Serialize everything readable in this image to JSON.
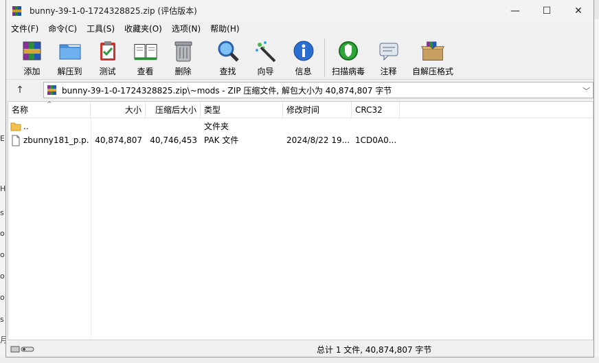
{
  "window": {
    "title": "bunny-39-1-0-1724328825.zip (评估版本)",
    "minimize": "—",
    "maximize": "☐",
    "close": "✕"
  },
  "menu": [
    "文件(F)",
    "命令(C)",
    "工具(S)",
    "收藏夹(O)",
    "选项(N)",
    "帮助(H)"
  ],
  "toolbar": {
    "add": "添加",
    "extract_to": "解压到",
    "test": "测试",
    "view": "查看",
    "delete": "删除",
    "find": "查找",
    "wizard": "向导",
    "info": "信息",
    "virus_scan": "扫描病毒",
    "comment": "注释",
    "sfx": "自解压格式"
  },
  "address": {
    "path": "bunny-39-1-0-1724328825.zip\\~mods - ZIP 压缩文件, 解包大小为 40,874,807 字节"
  },
  "columns": {
    "name": "名称",
    "size": "大小",
    "packed": "压缩后大小",
    "type": "类型",
    "modified": "修改时间",
    "crc": "CRC32"
  },
  "rows": [
    {
      "name": "..",
      "size": "",
      "packed": "",
      "type": "文件夹",
      "modified": "",
      "crc": ""
    },
    {
      "name": "zbunny181_p.p...",
      "size": "40,874,807",
      "packed": "40,746,453",
      "type": "PAK 文件",
      "modified": "2024/8/22 19...",
      "crc": "1CD0A0..."
    }
  ],
  "status": {
    "summary": "总计 1 文件, 40,874,807 字节"
  },
  "colors": {
    "titlebar": "#f3f3f3",
    "window_bg": "#f0f0f0",
    "list_bg": "#ffffff"
  }
}
